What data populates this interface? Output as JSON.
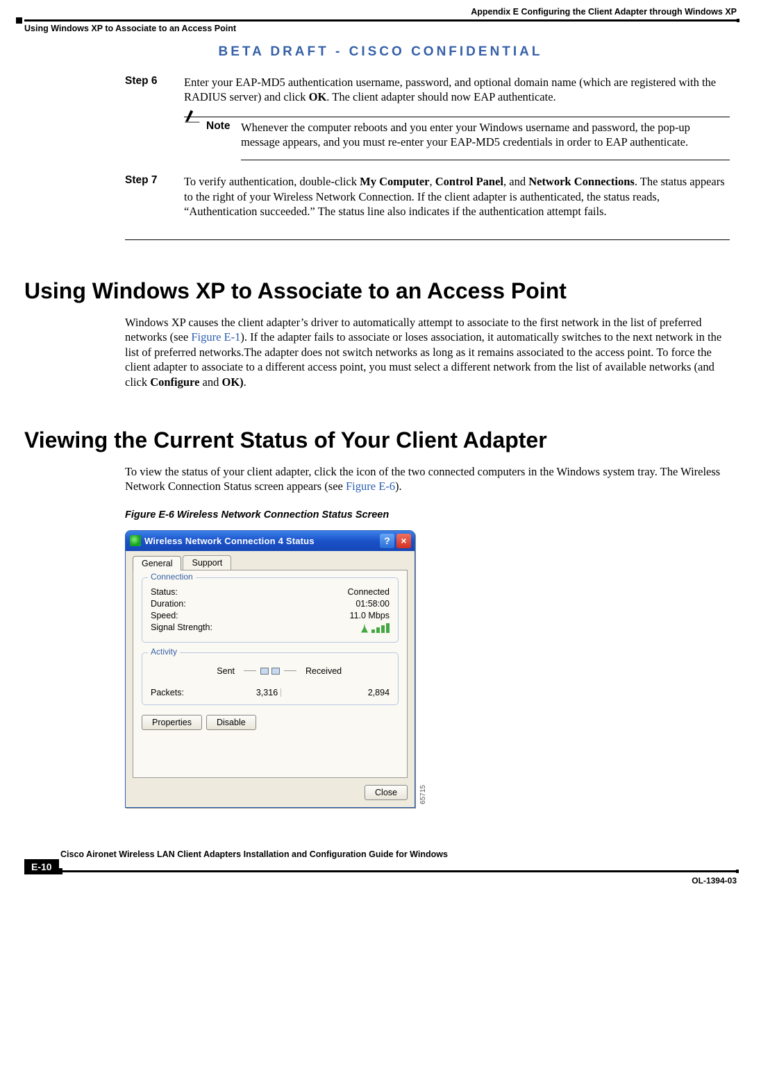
{
  "header": {
    "appendix": "Appendix E      Configuring the Client Adapter through Windows XP",
    "section": "Using Windows XP to Associate to an Access Point"
  },
  "beta": "BETA DRAFT - CISCO CONFIDENTIAL",
  "step6": {
    "label": "Step 6",
    "text_before_ok": "Enter your EAP-MD5 authentication username, password, and optional domain name (which are registered with the RADIUS server) and click ",
    "ok": "OK",
    "text_after_ok": ". The client adapter should now EAP authenticate."
  },
  "note": {
    "label": "Note",
    "text": "Whenever the computer reboots and you enter your Windows username and password, the pop-up message appears, and you must re-enter your EAP-MD5 credentials in order to EAP authenticate."
  },
  "step7": {
    "label": "Step 7",
    "pre": "To verify authentication, double-click ",
    "b1": "My Computer",
    "mid1": ", ",
    "b2": "Control Panel",
    "mid2": ", and ",
    "b3": "Network Connections",
    "post": ". The status appears to the right of your Wireless Network Connection. If the client adapter is authenticated, the status reads, “Authentication succeeded.” The status line also indicates if the authentication attempt fails."
  },
  "h1a": "Using Windows XP to Associate to an Access Point",
  "para1": {
    "t1": "Windows XP causes the client adapter’s driver to automatically attempt to associate to the first network in the list of preferred networks (see ",
    "link1": "Figure E-1",
    "t2": "). If the adapter fails to associate or loses association, it automatically switches to the next network in the list of preferred networks.The adapter does not switch networks as long as it remains associated to the access point. To force the client adapter to associate to a different access point, you must select a different network from the list of available networks (and click ",
    "b1": "Configure",
    "t3": " and ",
    "b2": "OK)",
    "t4": "."
  },
  "h1b": "Viewing the Current Status of Your Client Adapter",
  "para2": {
    "t1": "To view the status of your client adapter, click the icon of the two connected computers in the Windows system tray. The Wireless Network Connection Status screen appears (see ",
    "link1": "Figure E-6",
    "t2": ")."
  },
  "figcaption": "Figure E-6     Wireless Network Connection Status Screen",
  "dialog": {
    "title": "Wireless Network Connection 4 Status",
    "help": "?",
    "close": "×",
    "tabs": {
      "general": "General",
      "support": "Support"
    },
    "connection": {
      "legend": "Connection",
      "status_l": "Status:",
      "status_v": "Connected",
      "duration_l": "Duration:",
      "duration_v": "01:58:00",
      "speed_l": "Speed:",
      "speed_v": "11.0 Mbps",
      "signal_l": "Signal Strength:"
    },
    "activity": {
      "legend": "Activity",
      "sent": "Sent",
      "received": "Received",
      "packets_l": "Packets:",
      "packets_sent": "3,316",
      "packets_recv": "2,894"
    },
    "buttons": {
      "properties": "Properties",
      "disable": "Disable",
      "closebtn": "Close"
    },
    "img_id": "65715"
  },
  "footer": {
    "page": "E-10",
    "title": "Cisco Aironet Wireless LAN Client Adapters Installation and Configuration Guide for Windows",
    "doc": "OL-1394-03"
  }
}
